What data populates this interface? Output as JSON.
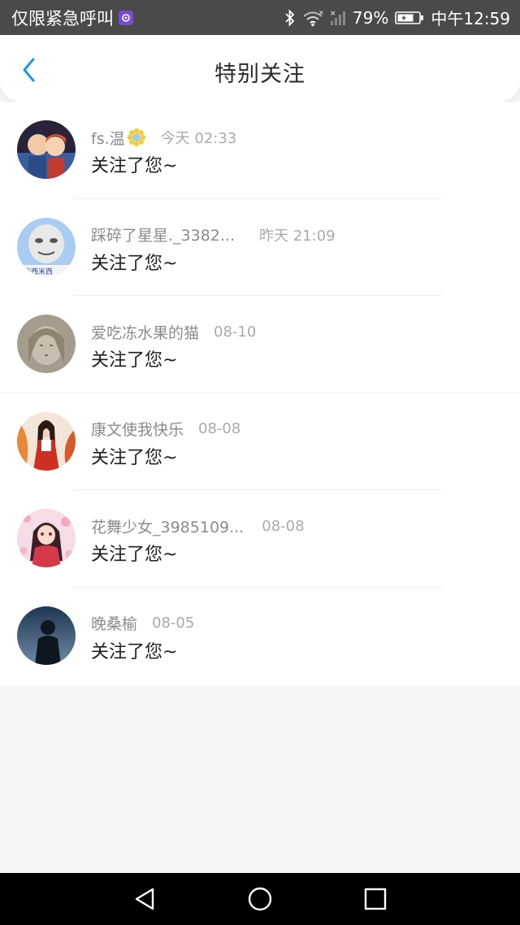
{
  "status_bar": {
    "carrier_text": "仅限紧急呼叫",
    "battery": "79%",
    "time": "中午12:59",
    "icons": [
      "carrier-app-icon",
      "bluetooth-icon",
      "wifi-icon",
      "signal-icon",
      "battery-icon"
    ]
  },
  "header": {
    "title": "特别关注",
    "back_icon": "chevron-left-icon",
    "accent_color": "#1a9ae8"
  },
  "follows": [
    {
      "username": "fs.温",
      "time": "今天 02:33",
      "message": "关注了您~",
      "avatar": "avatar-anime-boys"
    },
    {
      "username": "踩碎了星星._3382...",
      "time": "昨天 21:09",
      "message": "关注了您~",
      "avatar": "avatar-meme-face"
    },
    {
      "username": "爱吃冻水果的猫",
      "time": "08-10",
      "message": "关注了您~",
      "avatar": "avatar-sketch-girl"
    },
    {
      "username": "康文使我快乐",
      "time": "08-08",
      "message": "关注了您~",
      "avatar": "avatar-shrine-maiden"
    },
    {
      "username": "花舞少女_3985109...",
      "time": "08-08",
      "message": "关注了您~",
      "avatar": "avatar-flower-girl"
    },
    {
      "username": "晚桑榆",
      "time": "08-05",
      "message": "关注了您~",
      "avatar": "avatar-silhouette"
    }
  ],
  "nav_bar": {
    "icons": [
      "back-triangle-icon",
      "home-circle-icon",
      "recents-square-icon"
    ]
  }
}
